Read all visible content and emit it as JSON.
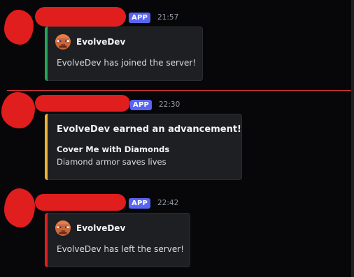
{
  "messages": [
    {
      "badge": "APP",
      "time": "21:57",
      "author": "EvolveDev",
      "description": "EvolveDev has joined the server!",
      "accent": "#23a55a"
    },
    {
      "badge": "APP",
      "time": "22:30",
      "title": "EvolveDev earned an advancement!",
      "field_name": "Cover Me with Diamonds",
      "field_value": "Diamond armor saves lives",
      "accent": "#f0b232"
    },
    {
      "badge": "APP",
      "time": "22:42",
      "author": "EvolveDev",
      "description": "EvolveDev has left the server!",
      "accent": "#e01e1e"
    }
  ],
  "colors": {
    "background": "#070709",
    "embed_background": "#1e1f22",
    "app_badge": "#5865f2",
    "new_messages_divider": "#e23b3b",
    "redaction": "#e01e1e"
  },
  "icons": {
    "author_icon": "minecraft-player-head-icon"
  }
}
